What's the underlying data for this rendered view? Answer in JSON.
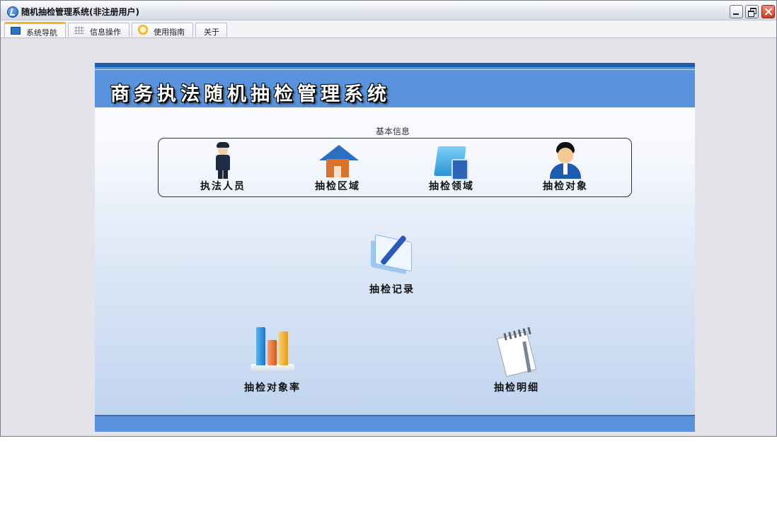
{
  "window": {
    "title": "随机抽检管理系统(非注册用户)",
    "controls": [
      "minimize-icon",
      "restore-icon",
      "close-icon"
    ]
  },
  "tabs": [
    {
      "label": "系统导航",
      "icon": "monitor-icon",
      "active": true
    },
    {
      "label": "信息操作",
      "icon": "grid-icon",
      "active": false
    },
    {
      "label": "使用指南",
      "icon": "guide-icon",
      "active": false
    },
    {
      "label": "关于",
      "icon": "",
      "active": false
    }
  ],
  "banner": {
    "title": "商务执法随机抽检管理系统"
  },
  "basic_info": {
    "group_label": "基本信息",
    "items": [
      {
        "label": "执法人员",
        "icon": "police-officer-icon"
      },
      {
        "label": "抽检区域",
        "icon": "house-icon"
      },
      {
        "label": "抽检领域",
        "icon": "folder-icon"
      },
      {
        "label": "抽检对象",
        "icon": "person-icon"
      }
    ]
  },
  "actions": [
    {
      "label": "抽检记录",
      "icon": "record-icon"
    },
    {
      "label": "抽检对象率",
      "icon": "bar-chart-icon"
    },
    {
      "label": "抽检明细",
      "icon": "notepad-icon"
    }
  ],
  "colors": {
    "banner": "#5a93dd",
    "banner_border": "#1a5fb4",
    "active_tab_accent": "#f5b52b"
  }
}
